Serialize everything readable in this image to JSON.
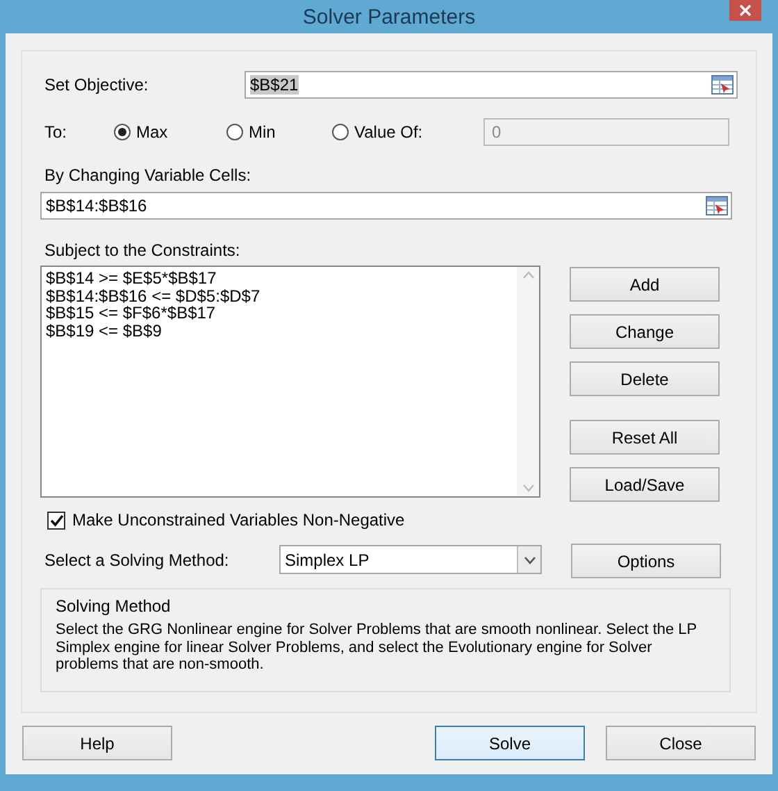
{
  "window": {
    "title": "Solver Parameters"
  },
  "objective": {
    "label": "Set Objective:",
    "value": "$B$21"
  },
  "to": {
    "label": "To:",
    "options": [
      {
        "label": "Max",
        "selected": true
      },
      {
        "label": "Min",
        "selected": false
      },
      {
        "label": "Value Of:",
        "selected": false
      }
    ],
    "value_field": {
      "value": "0",
      "disabled": true
    }
  },
  "changing_cells": {
    "label": "By Changing Variable Cells:",
    "value": "$B$14:$B$16"
  },
  "constraints": {
    "label": "Subject to the Constraints:",
    "items": [
      "$B$14 >= $E$5*$B$17",
      "$B$14:$B$16 <= $D$5:$D$7",
      "$B$15 <= $F$6*$B$17",
      "$B$19 <= $B$9"
    ]
  },
  "constraint_buttons": [
    {
      "label": "Add"
    },
    {
      "label": "Change"
    },
    {
      "label": "Delete"
    },
    {
      "label": "Reset All"
    },
    {
      "label": "Load/Save"
    }
  ],
  "non_negative": {
    "label": "Make Unconstrained Variables Non-Negative",
    "checked": true
  },
  "solving_method": {
    "label": "Select a Solving Method:",
    "value": "Simplex LP"
  },
  "options_button": {
    "label": "Options"
  },
  "method_group": {
    "title": "Solving Method",
    "text": "Select the GRG Nonlinear engine for Solver Problems that are smooth nonlinear. Select the LP Simplex engine for linear Solver Problems, and select the Evolutionary engine for Solver problems that are non-smooth."
  },
  "footer": {
    "left_buttons": [
      {
        "label": "Help",
        "default": false
      }
    ],
    "right_buttons": [
      {
        "label": "Solve",
        "default": true
      },
      {
        "label": "Close",
        "default": false
      }
    ]
  }
}
